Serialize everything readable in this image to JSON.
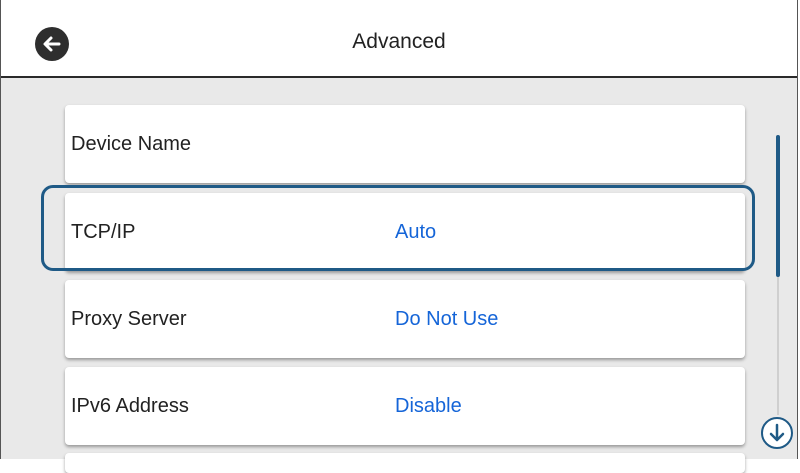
{
  "header": {
    "title": "Advanced",
    "back_icon": "arrow-left-icon"
  },
  "settings": {
    "items": [
      {
        "label": "Device Name",
        "value": ""
      },
      {
        "label": "TCP/IP",
        "value": "Auto"
      },
      {
        "label": "Proxy Server",
        "value": "Do Not Use"
      },
      {
        "label": "IPv6 Address",
        "value": "Disable"
      }
    ],
    "selected_index": 1
  },
  "scroll": {
    "down_icon": "arrow-down-circle-icon"
  },
  "colors": {
    "value_text": "#1565d8",
    "focus_frame": "#1f5a86",
    "background": "#e9e9e9"
  }
}
